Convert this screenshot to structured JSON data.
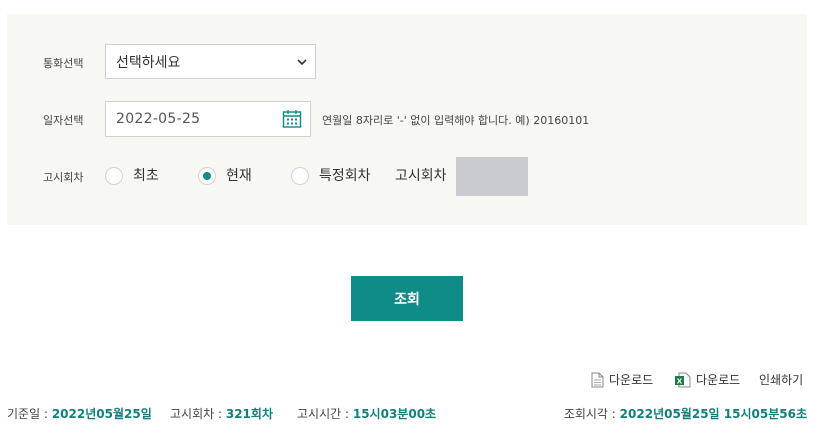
{
  "form": {
    "currency_label": "통화선택",
    "currency_value": "선택하세요",
    "date_label": "일자선택",
    "date_value": "2022-05-25",
    "date_hint": "연월일 8자리로 '-' 없이 입력해야 합니다. 예) 20160101",
    "round_label": "고시회차",
    "radio_options": [
      "최초",
      "현재",
      "특정회차"
    ],
    "selected_option": "현재",
    "specific_round_label": "고시회차"
  },
  "query_button": "조회",
  "downloads": {
    "pdf_download": "다운로드",
    "excel_download": "다운로드",
    "print": "인쇄하기"
  },
  "info": {
    "base_date_label": "기준일 :",
    "base_date_value": "2022년05월25일",
    "round_label": "고시회차 :",
    "round_value": "321회차",
    "time_label": "고시시간 :",
    "time_value": "15시03분00초",
    "query_time_label": "조회시각 :",
    "query_time_value": "2022년05월25일 15시05분56초"
  },
  "colors": {
    "accent": "#0f8c88",
    "panel_bg": "#f7f7f4"
  }
}
